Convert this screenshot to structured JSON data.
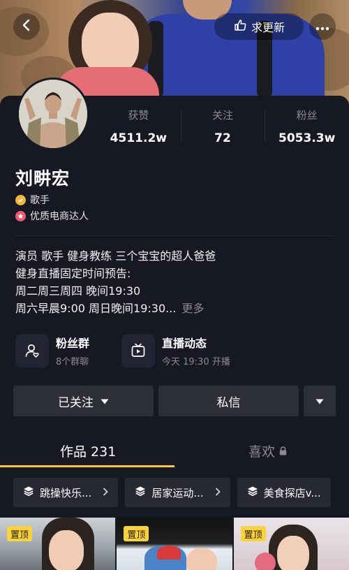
{
  "header": {
    "back_icon": "chevron-left-icon",
    "update_label": "求更新",
    "update_icon": "hand-point-icon",
    "more_icon": "ellipsis-icon"
  },
  "profile": {
    "name": "刘畊宏",
    "tags": [
      {
        "label": "歌手",
        "icon": "verified-badge-icon",
        "color": "#f2b43c"
      },
      {
        "label": "优质电商达人",
        "icon": "star-badge-icon",
        "color": "#ee5b70"
      }
    ],
    "stats": [
      {
        "label": "获赞",
        "value": "4511.2w"
      },
      {
        "label": "关注",
        "value": "72"
      },
      {
        "label": "粉丝",
        "value": "5053.3w"
      }
    ],
    "bio_lines": [
      "演员 歌手 健身教练 三个宝宝的超人爸爸",
      "健身直播固定时间预告:",
      "周二周三周四 晚间19:30",
      "周六早晨9:00 周日晚间19:30..."
    ],
    "bio_more": "更多"
  },
  "features": [
    {
      "title": "粉丝群",
      "subtitle": "8个群聊",
      "icon": "fan-group-icon"
    },
    {
      "title": "直播动态",
      "subtitle": "今天 19:30 开播",
      "icon": "live-tv-icon"
    }
  ],
  "actions": {
    "followed_label": "已关注",
    "message_label": "私信"
  },
  "tabs": {
    "works_label": "作品 231",
    "likes_label": "喜欢"
  },
  "collections": [
    {
      "label": "跳操快乐..."
    },
    {
      "label": "居家运动..."
    },
    {
      "label": "美食探店v..."
    }
  ],
  "videos": [
    {
      "pin_label": "置顶"
    },
    {
      "pin_label": "置顶"
    },
    {
      "pin_label": "置顶"
    }
  ],
  "colors": {
    "background": "#161823",
    "accent": "#f8c646",
    "muted_text": "#8a8b91",
    "button": "#2c2e38"
  }
}
